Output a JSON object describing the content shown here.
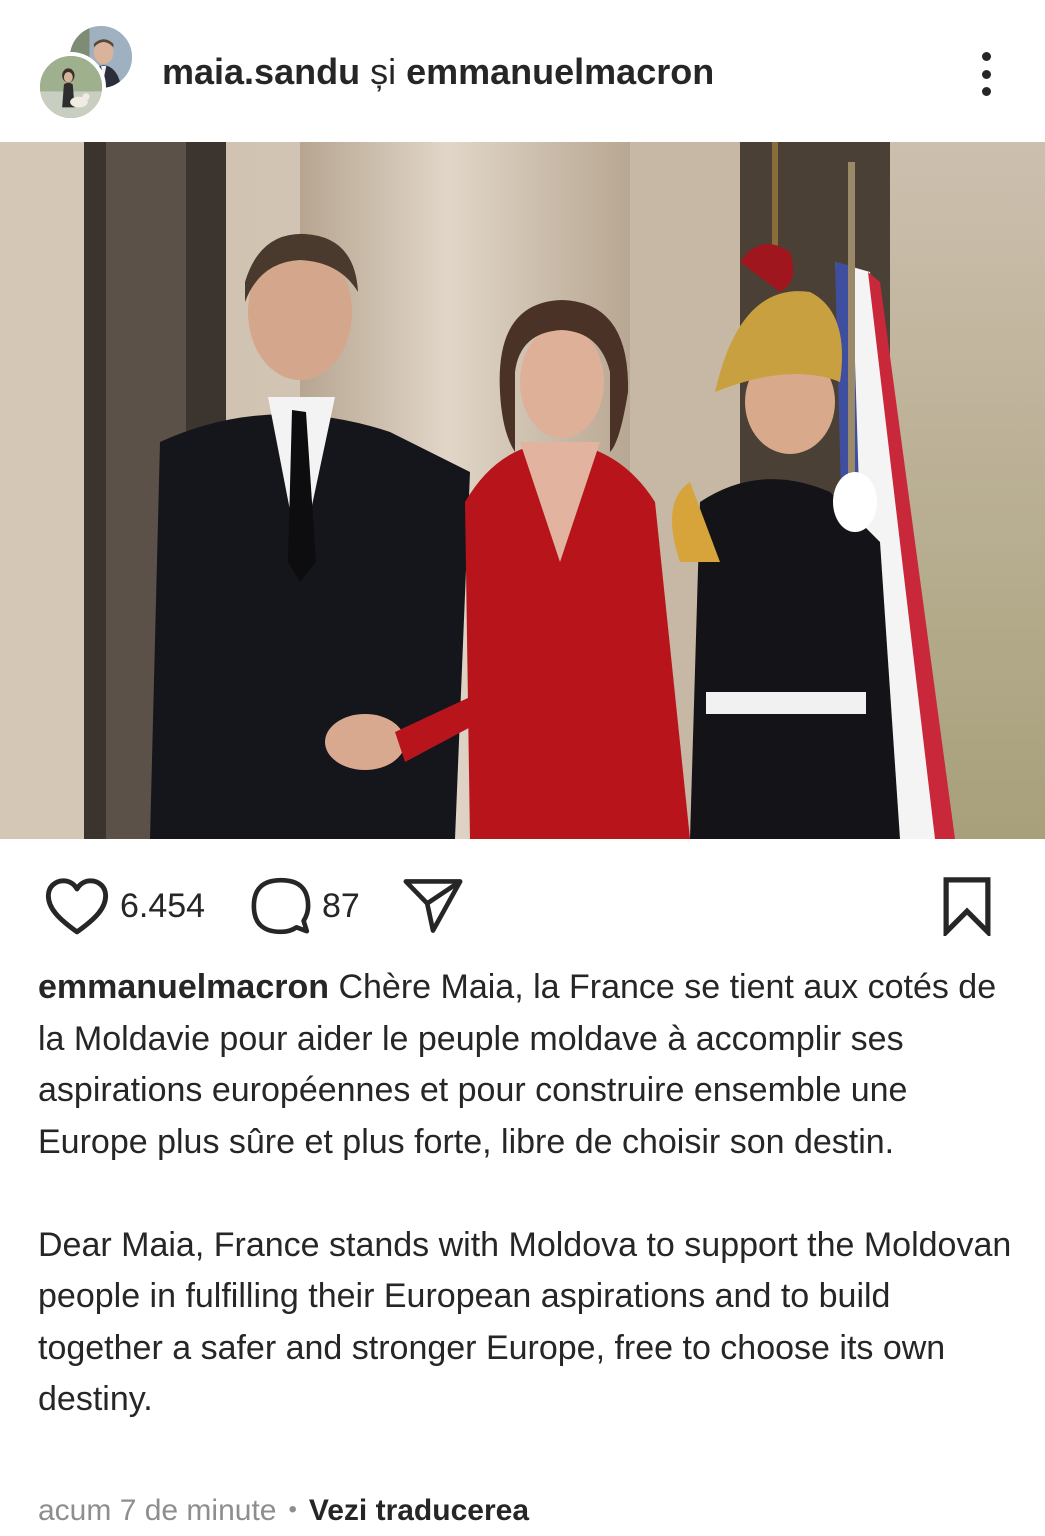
{
  "header": {
    "user_primary": "maia.sandu",
    "conjunction": " și ",
    "user_secondary": "emmanuelmacron",
    "more_icon": "more-vertical-icon"
  },
  "post": {
    "image_alt": "Photo of Emmanuel Macron and Maia Sandu shaking hands in front of a building, with a uniformed Republican Guard and French flag",
    "tag_icon": "person-tag-icon"
  },
  "actions": {
    "like_icon": "heart-icon",
    "likes": "6.454",
    "comment_icon": "comment-icon",
    "comments": "87",
    "share_icon": "send-icon",
    "save_icon": "bookmark-icon"
  },
  "caption": {
    "author": "emmanuelmacron",
    "text_fr": " Chère Maia, la France se tient aux cotés de la Moldavie pour aider le peuple moldave à accomplir ses aspirations européennes et pour construire ensemble une Europe plus sûre et plus forte, libre de choisir son destin.",
    "text_en": "Dear Maia, France stands with Moldova to support the Moldovan people in fulfilling their European aspirations and to build together a safer and stronger Europe, free to choose its own destiny."
  },
  "meta": {
    "time": "acum 7 de minute",
    "separator": "•",
    "translate": "Vezi traducerea"
  },
  "colors": {
    "text": "#262626",
    "muted": "#8e8e8e",
    "background": "#ffffff"
  }
}
